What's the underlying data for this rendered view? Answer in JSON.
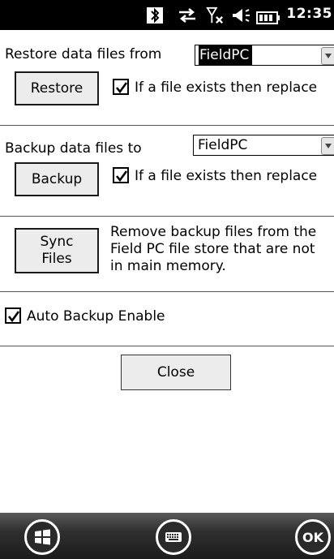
{
  "status_bar": {
    "time": "12:35",
    "icons": [
      "bluetooth-icon",
      "sync-icon",
      "signal-off-icon",
      "volume-icon",
      "battery-icon"
    ]
  },
  "restore": {
    "label": "Restore data files from",
    "source_value": "FieldPC",
    "button_label": "Restore",
    "replace_checkbox": {
      "label": "If a file exists then replace",
      "checked": true
    }
  },
  "backup": {
    "label": "Backup data files to",
    "target_value": "FieldPC",
    "button_label": "Backup",
    "replace_checkbox": {
      "label": "If a file exists then replace",
      "checked": true
    }
  },
  "sync": {
    "button_line1": "Sync",
    "button_line2": "Files",
    "desc_line1": "Remove backup files from the",
    "desc_line2": "Field PC file store that are not",
    "desc_line3": "in main memory."
  },
  "auto_backup": {
    "label": "Auto Backup Enable",
    "checked": true
  },
  "close_label": "Close",
  "softkeys": {
    "ok_label": "OK",
    "left": "windows-start-icon",
    "center": "keyboard-icon"
  }
}
